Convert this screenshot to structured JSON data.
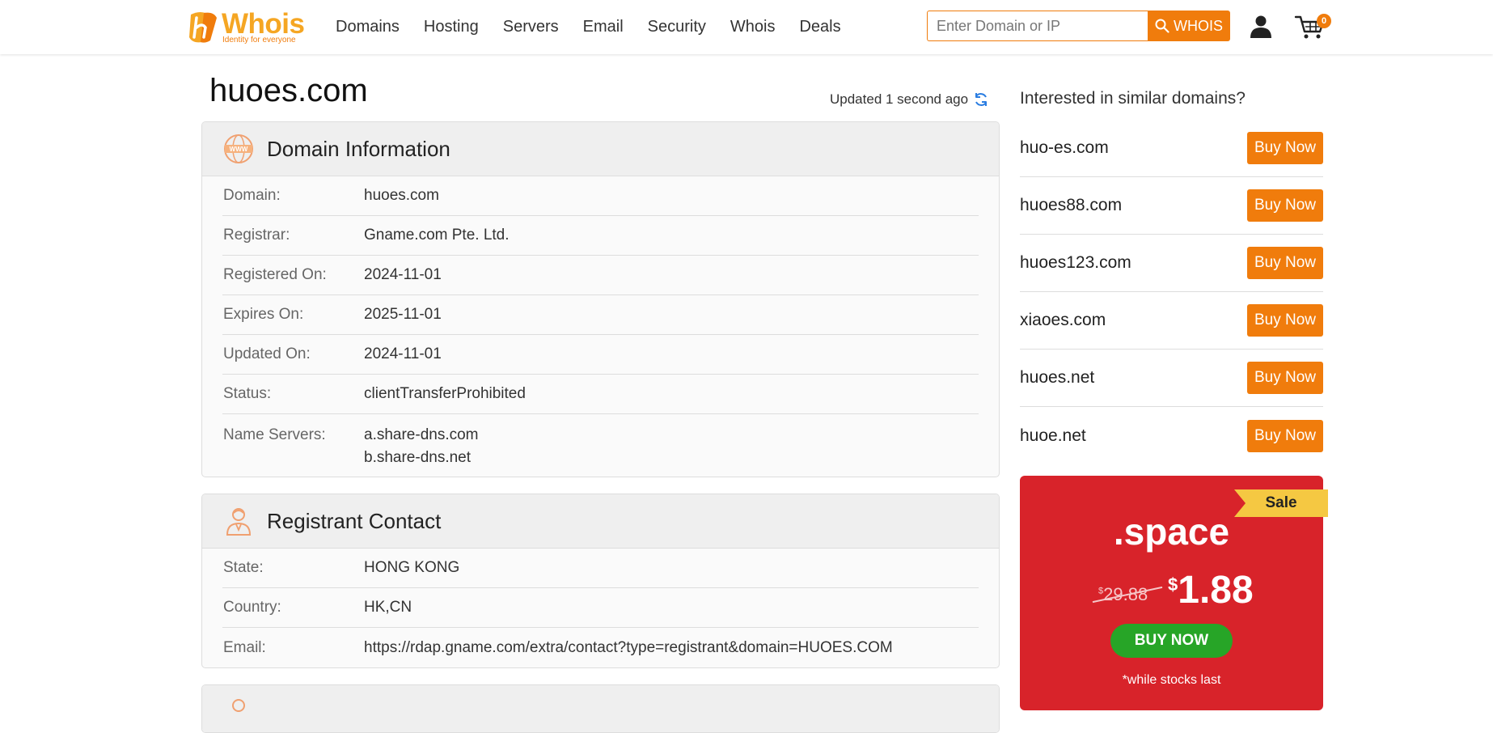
{
  "header": {
    "logo_text": "Whois",
    "logo_tagline": "Identity for everyone",
    "nav": [
      "Domains",
      "Hosting",
      "Servers",
      "Email",
      "Security",
      "Whois",
      "Deals"
    ],
    "search_placeholder": "Enter Domain or IP",
    "search_button": "WHOIS",
    "cart_count": "0"
  },
  "page": {
    "title": "huoes.com",
    "updated": "Updated 1 second ago"
  },
  "domain_info": {
    "title": "Domain Information",
    "rows": [
      {
        "label": "Domain:",
        "value": "huoes.com"
      },
      {
        "label": "Registrar:",
        "value": "Gname.com Pte. Ltd."
      },
      {
        "label": "Registered On:",
        "value": "2024-11-01"
      },
      {
        "label": "Expires On:",
        "value": "2025-11-01"
      },
      {
        "label": "Updated On:",
        "value": "2024-11-01"
      },
      {
        "label": "Status:",
        "value": "clientTransferProhibited"
      }
    ],
    "name_servers_label": "Name Servers:",
    "name_servers": [
      "a.share-dns.com",
      "b.share-dns.net"
    ]
  },
  "registrant": {
    "title": "Registrant Contact",
    "rows": [
      {
        "label": "State:",
        "value": "HONG KONG"
      },
      {
        "label": "Country:",
        "value": "HK,CN"
      },
      {
        "label": "Email:",
        "value": "https://rdap.gname.com/extra/contact?type=registrant&domain=HUOES.COM"
      }
    ]
  },
  "sidebar": {
    "title": "Interested in similar domains?",
    "buy_label": "Buy Now",
    "suggestions": [
      "huo-es.com",
      "huoes88.com",
      "huoes123.com",
      "xiaoes.com",
      "huoes.net",
      "huoe.net"
    ]
  },
  "promo": {
    "ribbon": "Sale",
    "tld": ".space",
    "currency": "$",
    "old_price": "29.88",
    "new_price": "1.88",
    "button": "BUY NOW",
    "note": "*while stocks last"
  },
  "colors": {
    "brand_orange": "#f07c0c",
    "promo_red": "#d8232a",
    "promo_green": "#27a527",
    "ribbon_yellow": "#f5c842"
  }
}
